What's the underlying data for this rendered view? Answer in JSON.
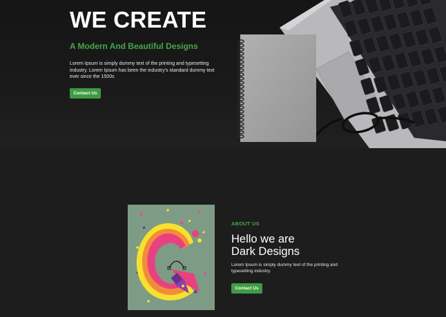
{
  "hero": {
    "title": "WE CREATE",
    "subtitle": "A Modern And Beautiful Designs",
    "description": "Lorem Ipsum is simply dummy text of the printing and typesetting industry. Lorem Ipsum has been the industry's standard dummy text ever since the 1500s",
    "cta_label": "Contact Us"
  },
  "about": {
    "eyebrow": "ABOUT US",
    "heading_line1": "Hello we are",
    "heading_line2": "Dark Designs",
    "description": "Lorem Ipsum is simply dummy text of the printing and typesetting industry.",
    "cta_label": "Contact Us"
  },
  "colors": {
    "accent": "#46a84a",
    "button": "#3f9b43",
    "background": "#1d1d1d",
    "art_background": "#7e9b86"
  },
  "icons": {
    "hero_image": "laptop-notebook-glasses-photo",
    "about_image": "letter-g-pen-tool-illustration"
  }
}
